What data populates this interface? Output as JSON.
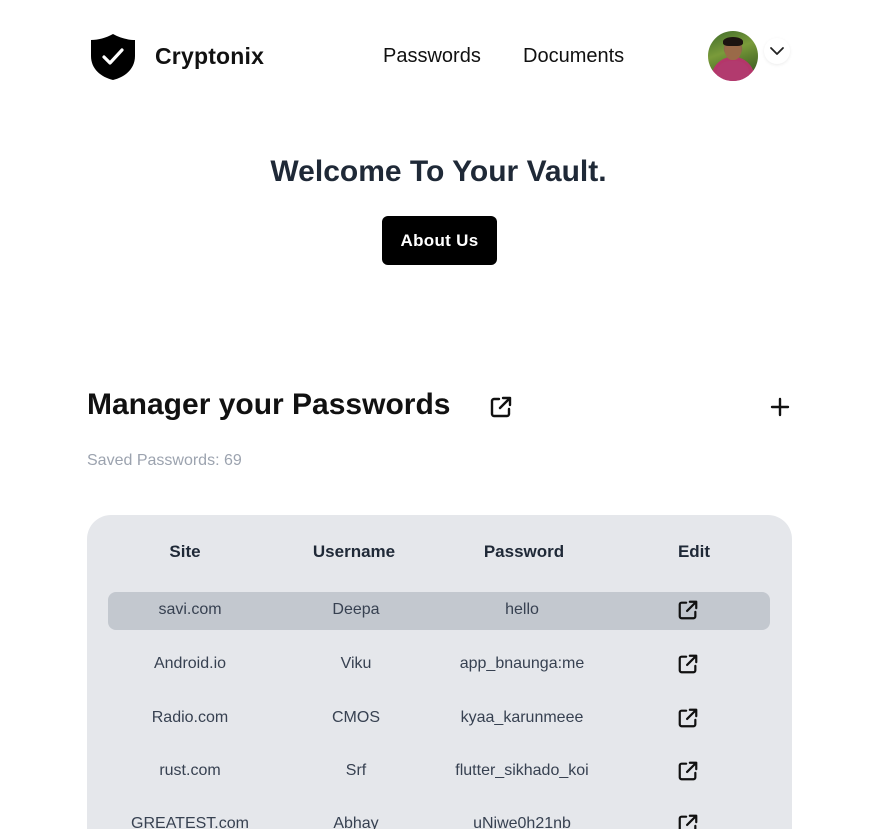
{
  "header": {
    "brand": "Cryptonix",
    "nav": {
      "passwords": "Passwords",
      "documents": "Documents"
    }
  },
  "hero": {
    "title": "Welcome To Your Vault.",
    "about_button": "About Us"
  },
  "manager": {
    "title": "Manager your Passwords",
    "saved_count": "Saved Passwords: 69"
  },
  "table": {
    "headers": {
      "site": "Site",
      "username": "Username",
      "password": "Password",
      "edit": "Edit"
    },
    "rows": [
      {
        "site": "savi.com",
        "username": "Deepa",
        "password": "hello"
      },
      {
        "site": "Android.io",
        "username": "Viku",
        "password": "app_bnaunga:me"
      },
      {
        "site": "Radio.com",
        "username": "CMOS",
        "password": "kyaa_karunmeee"
      },
      {
        "site": "rust.com",
        "username": "Srf",
        "password": "flutter_sikhado_koi"
      },
      {
        "site": "GREATEST.com",
        "username": "Abhay",
        "password": "uNiwe0h21nb"
      }
    ]
  },
  "colors": {
    "accent": "#000000",
    "table_bg": "#e5e7eb",
    "selected_row": "#c3c8cf",
    "muted_text": "#9ca3af"
  },
  "icons": {
    "logo": "shield-check-icon",
    "open": "external-link-icon",
    "add": "plus-icon",
    "dropdown": "chevron-down-icon",
    "edit": "external-link-icon"
  }
}
